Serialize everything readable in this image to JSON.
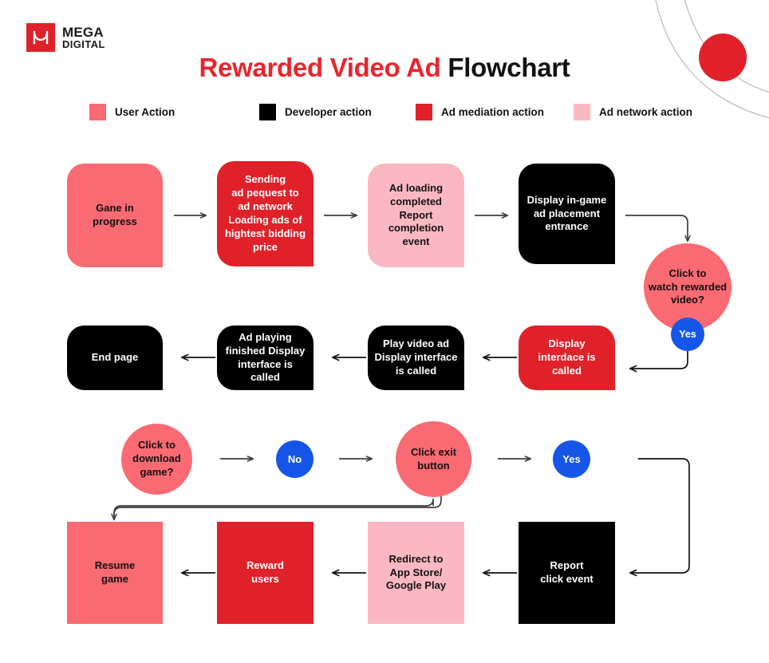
{
  "brand": {
    "logo_icon": "mega-digital-logo-icon",
    "name_line1": "MEGA",
    "name_line2": "DIGITAL",
    "logo_bg": "#e0212a"
  },
  "header": {
    "title_highlight": "Rewarded Video Ad",
    "title_rest": "Flowchart",
    "highlight_color": "#e8252e"
  },
  "legend": {
    "items": [
      {
        "label": "User Action",
        "color": "#fa6a72"
      },
      {
        "label": "Developer action",
        "color": "#000000"
      },
      {
        "label": "Ad mediation action",
        "color": "#e0212a"
      },
      {
        "label": "Ad network action",
        "color": "#fbb8c2"
      }
    ]
  },
  "colors": {
    "user_action": "#fa6a72",
    "developer_action": "#000000",
    "ad_mediation": "#e0212a",
    "ad_network": "#fbb8c2",
    "decision_yes_no": "#1556e8",
    "connector": "#3d3d3d",
    "text_dark": "#111111",
    "text_light": "#ffffff"
  },
  "flow": {
    "row1": [
      {
        "id": "game-in-progress",
        "text": "Gane in\nprogress",
        "fill": "#fa6a72",
        "text_color": "#111111"
      },
      {
        "id": "sending-ad-request",
        "text": "Sending\nad pequest to\nad network\nLoading ads of\nhightest bidding\nprice",
        "fill": "#e0212a",
        "text_color": "#ffffff"
      },
      {
        "id": "ad-loading-done",
        "text": "Ad loading\ncompleted Report\ncompletion\nevent",
        "fill": "#fbb8c2",
        "text_color": "#111111"
      },
      {
        "id": "display-placement",
        "text": "Display in-game\nad placement\nentrance",
        "fill": "#000000",
        "text_color": "#ffffff"
      }
    ],
    "decision1": {
      "id": "click-watch-rewarded-video",
      "text": "Click to\nwatch rewarded\nvideo?",
      "fill": "#fa6a72",
      "text_color": "#111111",
      "badge": "Yes"
    },
    "row2": [
      {
        "id": "end-page",
        "text": "End page",
        "fill": "#000000",
        "text_color": "#ffffff"
      },
      {
        "id": "ad-playing-finished",
        "text": "Ad playing\nfinished Display\ninterface is called",
        "fill": "#000000",
        "text_color": "#ffffff"
      },
      {
        "id": "play-video-ad",
        "text": "Play video ad\nDisplay interface\nis called",
        "fill": "#000000",
        "text_color": "#ffffff"
      },
      {
        "id": "display-interface",
        "text": "Display\ninterdace is\ncalled",
        "fill": "#e0212a",
        "text_color": "#ffffff"
      }
    ],
    "row3": [
      {
        "id": "click-download-game",
        "type": "circle",
        "text": "Click to\ndownload\ngame?",
        "fill": "#fa6a72",
        "text_color": "#111111"
      },
      {
        "id": "answer-no",
        "type": "badge",
        "text": "No",
        "fill": "#1556e8",
        "text_color": "#ffffff"
      },
      {
        "id": "click-exit-button",
        "type": "circle",
        "text": "Click exit\nbutton",
        "fill": "#fa6a72",
        "text_color": "#111111"
      },
      {
        "id": "answer-yes",
        "type": "badge",
        "text": "Yes",
        "fill": "#1556e8",
        "text_color": "#ffffff"
      }
    ],
    "row4": [
      {
        "id": "resume-game",
        "text": "Resume\ngame",
        "fill": "#fa6a72",
        "text_color": "#111111"
      },
      {
        "id": "reward-users",
        "text": "Reward\nusers",
        "fill": "#e0212a",
        "text_color": "#ffffff"
      },
      {
        "id": "redirect-store",
        "text": "Redirect to\nApp Store/\nGoogle Play",
        "fill": "#fbb8c2",
        "text_color": "#111111"
      },
      {
        "id": "report-click",
        "text": "Report\nclick event",
        "fill": "#000000",
        "text_color": "#ffffff"
      }
    ]
  }
}
